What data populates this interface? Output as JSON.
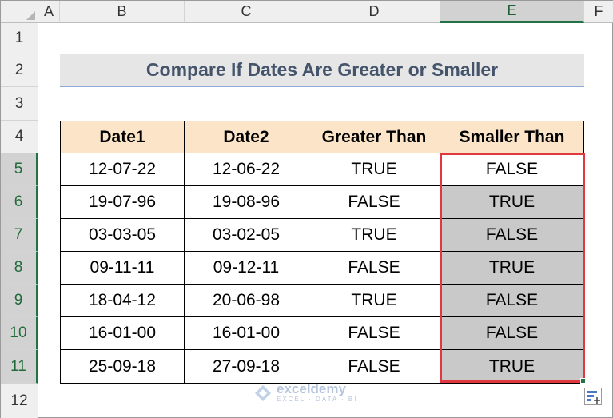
{
  "columns": [
    "A",
    "B",
    "C",
    "D",
    "E",
    "F"
  ],
  "rows": [
    "1",
    "2",
    "3",
    "4",
    "5",
    "6",
    "7",
    "8",
    "9",
    "10",
    "11",
    "12"
  ],
  "title": "Compare If Dates Are Greater or Smaller",
  "table": {
    "headers": [
      "Date1",
      "Date2",
      "Greater Than",
      "Smaller Than"
    ],
    "rows": [
      [
        "12-07-22",
        "12-06-22",
        "TRUE",
        "FALSE"
      ],
      [
        "19-07-96",
        "19-08-96",
        "FALSE",
        "TRUE"
      ],
      [
        "03-03-05",
        "03-02-05",
        "TRUE",
        "FALSE"
      ],
      [
        "09-11-11",
        "09-12-11",
        "FALSE",
        "TRUE"
      ],
      [
        "18-04-12",
        "20-06-98",
        "TRUE",
        "FALSE"
      ],
      [
        "16-01-00",
        "16-01-00",
        "FALSE",
        "FALSE"
      ],
      [
        "25-09-18",
        "27-09-18",
        "FALSE",
        "TRUE"
      ]
    ]
  },
  "selection": {
    "column": "E",
    "rows": [
      "5",
      "6",
      "7",
      "8",
      "9",
      "10",
      "11"
    ]
  },
  "watermark": {
    "name": "exceldemy",
    "tagline": "EXCEL · DATA · BI"
  },
  "colors": {
    "accent": "#217346",
    "selection_border": "#e0383e",
    "header_fill": "#fce4c8",
    "highlight_fill": "#c9c9c9",
    "title_text": "#44546a"
  },
  "icons": {
    "quick_analysis": "quick-analysis-icon",
    "select_all": "select-all-icon"
  }
}
